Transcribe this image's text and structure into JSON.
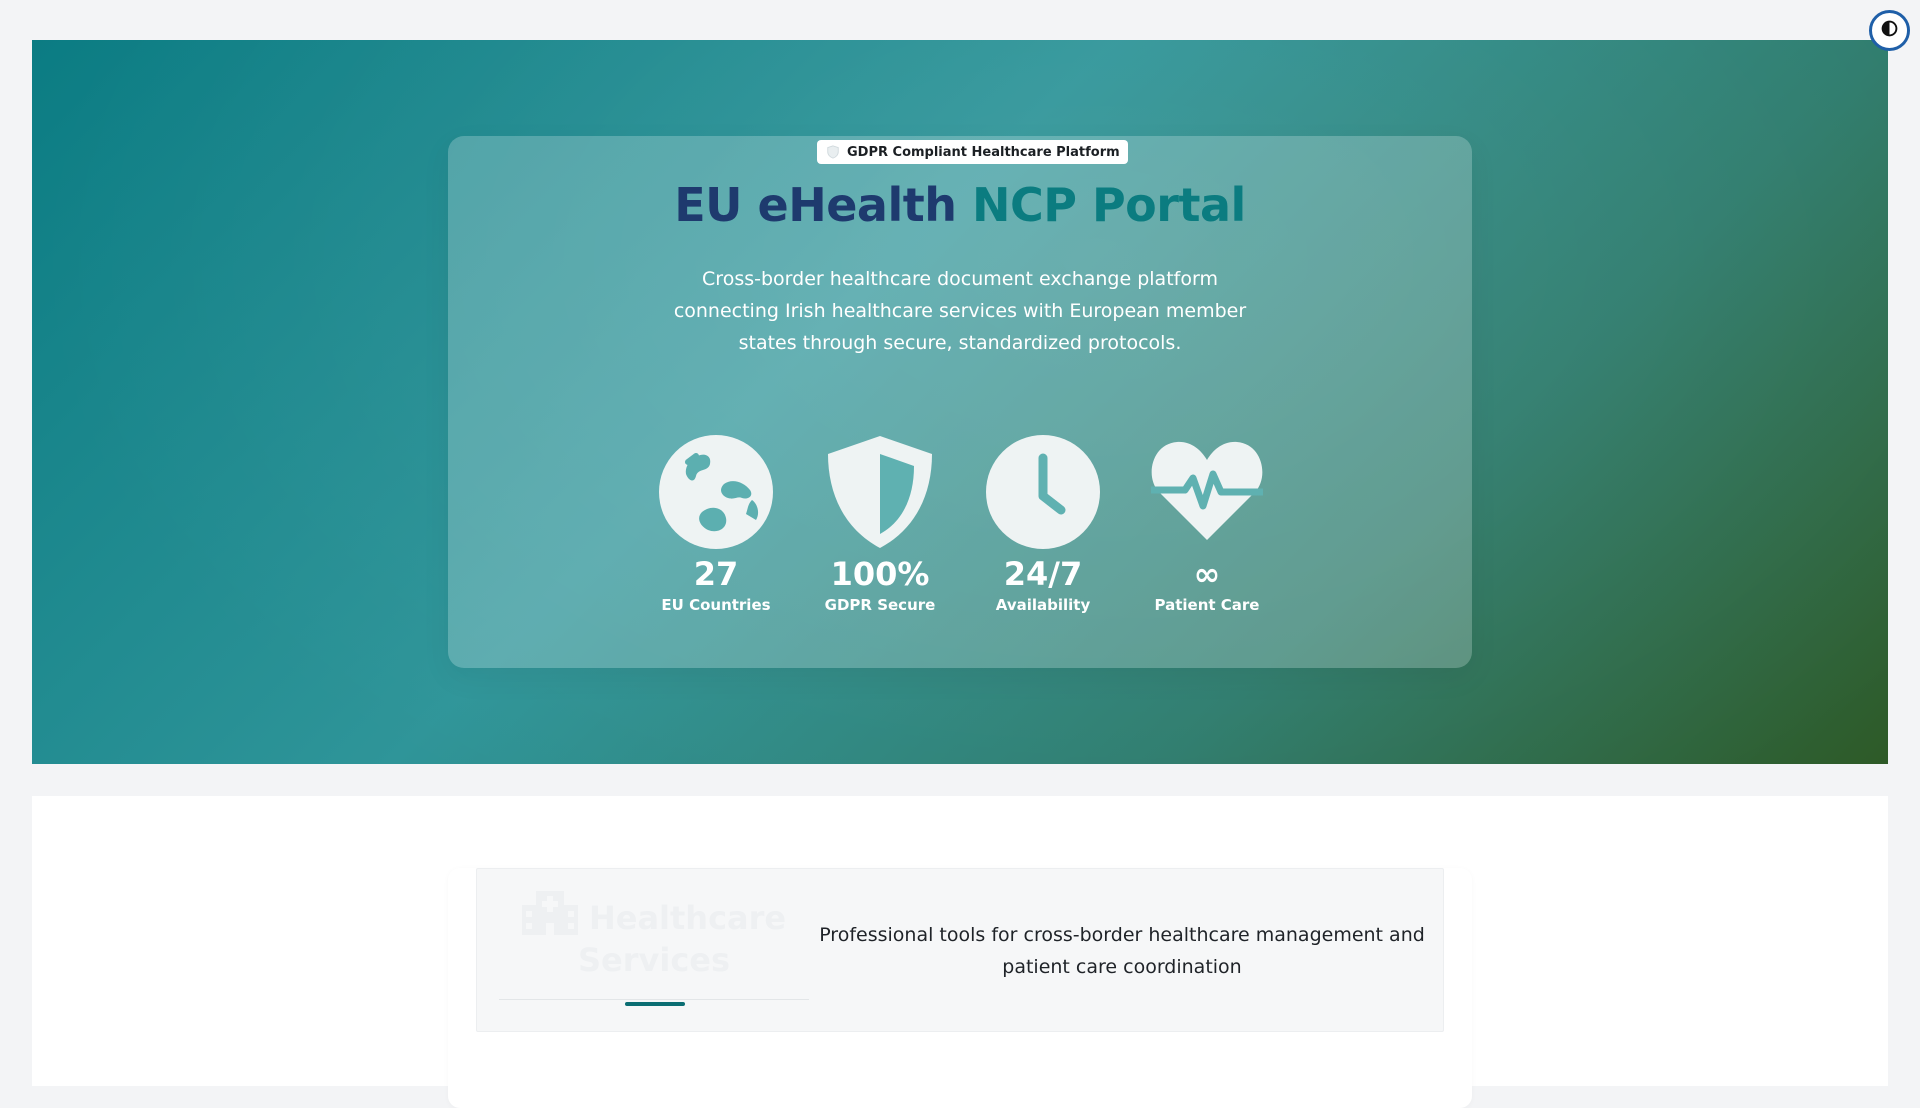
{
  "theme_toggle": {
    "icon": "contrast-icon"
  },
  "hero": {
    "badge": {
      "icon": "shield-check-icon",
      "label": "GDPR Compliant Healthcare Platform"
    },
    "title_part1": "EU eHealth",
    "title_part2": "NCP Portal",
    "description": "Cross-border healthcare document exchange platform connecting Irish healthcare services with European member states through secure, standardized protocols.",
    "stats": [
      {
        "icon": "globe-icon",
        "value": "27",
        "label": "EU Countries"
      },
      {
        "icon": "shield-icon",
        "value": "100%",
        "label": "GDPR Secure"
      },
      {
        "icon": "clock-icon",
        "value": "24/7",
        "label": "Availability"
      },
      {
        "icon": "heart-pulse-icon",
        "value": "∞",
        "label": "Patient Care"
      }
    ]
  },
  "services": {
    "icon": "hospital-icon",
    "title": "Healthcare Services",
    "description": "Professional tools for cross-border healthcare management and patient care coordination"
  },
  "colors": {
    "title_dark": "#1e3a6e",
    "title_teal": "#0b7c80",
    "accent": "#0b6e73",
    "gradient_start": "#0b7c83",
    "gradient_end": "#2e5a27"
  }
}
